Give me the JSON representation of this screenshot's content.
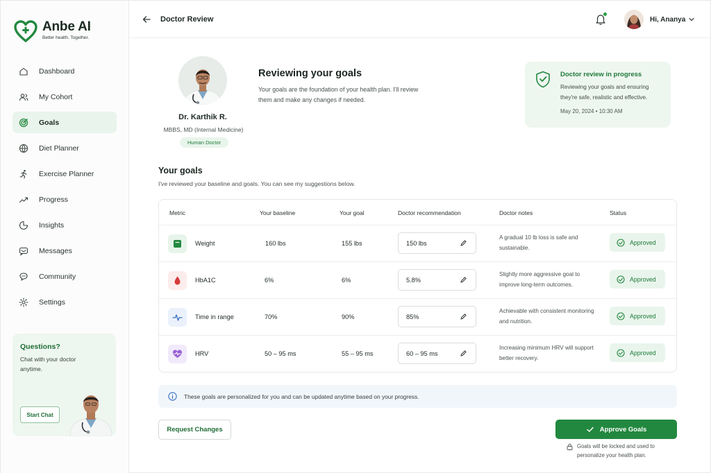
{
  "brand": {
    "name": "Anbe AI",
    "tagline": "Better health. Together.",
    "accent": "#23883f"
  },
  "sidebar": {
    "items": [
      {
        "label": "Dashboard",
        "icon": "home-icon"
      },
      {
        "label": "My Cohort",
        "icon": "users-icon"
      },
      {
        "label": "Goals",
        "icon": "target-icon",
        "active": true
      },
      {
        "label": "Diet Planner",
        "icon": "globe-icon"
      },
      {
        "label": "Exercise Planner",
        "icon": "running-icon"
      },
      {
        "label": "Progress",
        "icon": "trend-icon"
      },
      {
        "label": "Insights",
        "icon": "pie-icon"
      },
      {
        "label": "Messages",
        "icon": "message-icon"
      },
      {
        "label": "Community",
        "icon": "community-icon"
      },
      {
        "label": "Settings",
        "icon": "gear-icon"
      }
    ],
    "help": {
      "title": "Questions?",
      "text": "Chat with your doctor anytime.",
      "button": "Start Chat"
    }
  },
  "header": {
    "title": "Doctor Review",
    "greeting": "Hi, Ananya"
  },
  "doctor": {
    "name": "Dr. Karthik R.",
    "credentials": "MBBS, MD (Internal Medicine)",
    "badge": "Human Doctor"
  },
  "review": {
    "title": "Reviewing your goals",
    "description": "Your goals are the foundation of your health plan. I'll review them and make any changes if needed."
  },
  "status_card": {
    "title": "Doctor review in progress",
    "description": "Reviewing your goals and ensuring they're safe, realistic and effective.",
    "timestamp": "May 20, 2024 • 10:30 AM"
  },
  "goals": {
    "title": "Your goals",
    "subtitle": "I've reviewed your baseline and goals.  You can see my suggestions below.",
    "columns": [
      "Metric",
      "Your baseline",
      "Your goal",
      "Doctor recommendation",
      "Doctor notes",
      "Status"
    ],
    "rows": [
      {
        "metric": "Weight",
        "baseline": "160 lbs",
        "goal": "155 lbs",
        "recommendation": "150 lbs",
        "notes": "A gradual 10 lb loss is safe and sustainable.",
        "status": "Approved"
      },
      {
        "metric": "HbA1C",
        "baseline": "6%",
        "goal": "6%",
        "recommendation": "5.8%",
        "notes": "Slightly more aggressive goal to improve long-term outcomes.",
        "status": "Approved"
      },
      {
        "metric": "Time in range",
        "baseline": "70%",
        "goal": "90%",
        "recommendation": "85%",
        "notes": "Achievable with consistent monitoring and nutrition.",
        "status": "Approved"
      },
      {
        "metric": "HRV",
        "baseline": "50 – 95 ms",
        "goal": "55 – 95 ms",
        "recommendation": "60 – 95 ms",
        "notes": "Increasing minimum HRV will support better recovery.",
        "status": "Approved"
      }
    ]
  },
  "info": {
    "text": "These goals are personalized for you and can be updated anytime based on your progress."
  },
  "actions": {
    "request": "Request Changes",
    "approve": "Approve Goals",
    "lock_note": "Goals will be locked and used to personalize your health plan."
  }
}
